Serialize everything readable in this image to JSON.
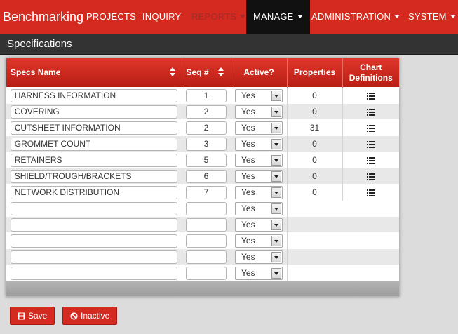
{
  "app": {
    "brand": "Benchmarking"
  },
  "nav": {
    "projects": "PROJECTS",
    "inquiry": "INQUIRY",
    "reports": "REPORTS",
    "manage": "MANAGE",
    "administration": "ADMINISTRATION",
    "system": "SYSTEM"
  },
  "page": {
    "title": "Specifications"
  },
  "table": {
    "headers": {
      "name": "Specs Name",
      "seq": "Seq #",
      "active": "Active?",
      "properties": "Properties",
      "chart_line1": "Chart",
      "chart_line2": "Definitions"
    },
    "rows": [
      {
        "name": "HARNESS INFORMATION",
        "seq": "1",
        "active": "Yes",
        "properties": "0"
      },
      {
        "name": "COVERING",
        "seq": "2",
        "active": "Yes",
        "properties": "0"
      },
      {
        "name": "CUTSHEET INFORMATION",
        "seq": "2",
        "active": "Yes",
        "properties": "31"
      },
      {
        "name": "GROMMET COUNT",
        "seq": "3",
        "active": "Yes",
        "properties": "0"
      },
      {
        "name": "RETAINERS",
        "seq": "5",
        "active": "Yes",
        "properties": "0"
      },
      {
        "name": "SHIELD/TROUGH/BRACKETS",
        "seq": "6",
        "active": "Yes",
        "properties": "0"
      },
      {
        "name": "NETWORK DISTRIBUTION",
        "seq": "7",
        "active": "Yes",
        "properties": "0"
      }
    ],
    "empty_rows": [
      {
        "active": "Yes"
      },
      {
        "active": "Yes"
      },
      {
        "active": "Yes"
      },
      {
        "active": "Yes"
      },
      {
        "active": "Yes"
      }
    ]
  },
  "buttons": {
    "save": "Save",
    "inactive": "Inactive"
  },
  "colors": {
    "brand_red": "#d42a1f",
    "section_bar": "#333333",
    "active_nav": "#111111"
  },
  "icons": {
    "chart_definitions": "list-icon",
    "save": "floppy-disk-icon",
    "inactive": "ban-icon",
    "sort": "sort-arrows-icon",
    "dropdown": "caret-down-icon"
  }
}
